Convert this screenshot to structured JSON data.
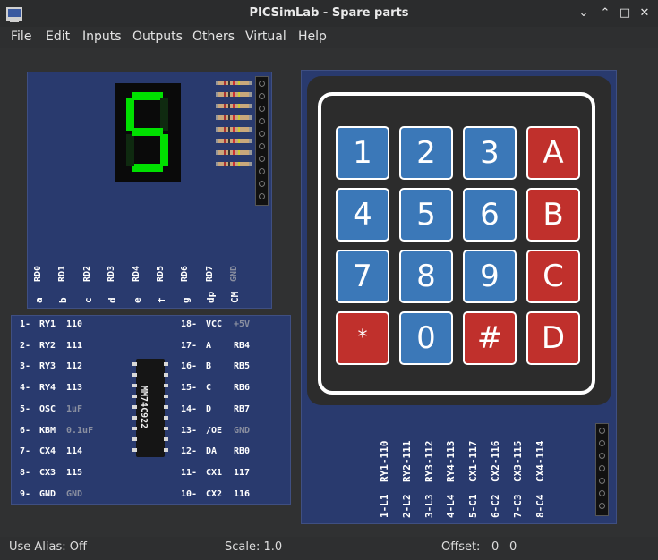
{
  "window": {
    "title": "PICSimLab - Spare parts",
    "minimize_glyph": "⌄",
    "maximize_glyph": "⌃",
    "restore_glyph": "□",
    "close_glyph": "✕"
  },
  "menu": [
    "File",
    "Edit",
    "Inputs",
    "Outputs",
    "Others",
    "Virtual",
    "Help"
  ],
  "display_part": {
    "port_pins": [
      "RD0",
      "RD1",
      "RD2",
      "RD3",
      "RD4",
      "RD5",
      "RD6",
      "RD7",
      "GND"
    ],
    "segment_pins": [
      "a",
      "b",
      "c",
      "d",
      "e",
      "f",
      "g",
      "dp",
      "CM"
    ],
    "digit": "5"
  },
  "encoder_part": {
    "ic_label": "MM74C922",
    "left_pins": [
      {
        "num": "1-",
        "name": "RY1",
        "val": "110"
      },
      {
        "num": "2-",
        "name": "RY2",
        "val": "111"
      },
      {
        "num": "3-",
        "name": "RY3",
        "val": "112"
      },
      {
        "num": "4-",
        "name": "RY4",
        "val": "113"
      },
      {
        "num": "5-",
        "name": "OSC",
        "val": "1uF"
      },
      {
        "num": "6-",
        "name": "KBM",
        "val": "0.1uF"
      },
      {
        "num": "7-",
        "name": "CX4",
        "val": "114"
      },
      {
        "num": "8-",
        "name": "CX3",
        "val": "115"
      },
      {
        "num": "9-",
        "name": "GND",
        "val": "GND"
      }
    ],
    "right_pins": [
      {
        "num": "18-",
        "name": "VCC",
        "val": "+5V"
      },
      {
        "num": "17-",
        "name": "A",
        "val": "RB4"
      },
      {
        "num": "16-",
        "name": "B",
        "val": "RB5"
      },
      {
        "num": "15-",
        "name": "C",
        "val": "RB6"
      },
      {
        "num": "14-",
        "name": "D",
        "val": "RB7"
      },
      {
        "num": "13-",
        "name": "/OE",
        "val": "GND"
      },
      {
        "num": "12-",
        "name": "DA",
        "val": "RB0"
      },
      {
        "num": "11-",
        "name": "CX1",
        "val": "117"
      },
      {
        "num": "10-",
        "name": "CX2",
        "val": "116"
      }
    ]
  },
  "keypad_part": {
    "keys": [
      "1",
      "2",
      "3",
      "A",
      "4",
      "5",
      "6",
      "B",
      "7",
      "8",
      "9",
      "C",
      "*",
      "0",
      "#",
      "D"
    ],
    "red_keys": [
      "A",
      "B",
      "C",
      "D",
      "*",
      "#"
    ],
    "pins": [
      {
        "pin": "1-L1",
        "val": "RY1-110"
      },
      {
        "pin": "2-L2",
        "val": "RY2-111"
      },
      {
        "pin": "3-L3",
        "val": "RY3-112"
      },
      {
        "pin": "4-L4",
        "val": "RY4-113"
      },
      {
        "pin": "5-C1",
        "val": "CX1-117"
      },
      {
        "pin": "6-C2",
        "val": "CX2-116"
      },
      {
        "pin": "7-C3",
        "val": "CX3-115"
      },
      {
        "pin": "8-C4",
        "val": "CX4-114"
      }
    ]
  },
  "status": {
    "alias": "Use Alias: Off",
    "scale": "Scale: 1.0",
    "offset": "Offset:",
    "offset_x": "0",
    "offset_y": "0"
  },
  "colors": {
    "board": "#293a6e",
    "key_blue": "#3b78b8",
    "key_red": "#c0302c",
    "segment_on": "#00e000"
  }
}
